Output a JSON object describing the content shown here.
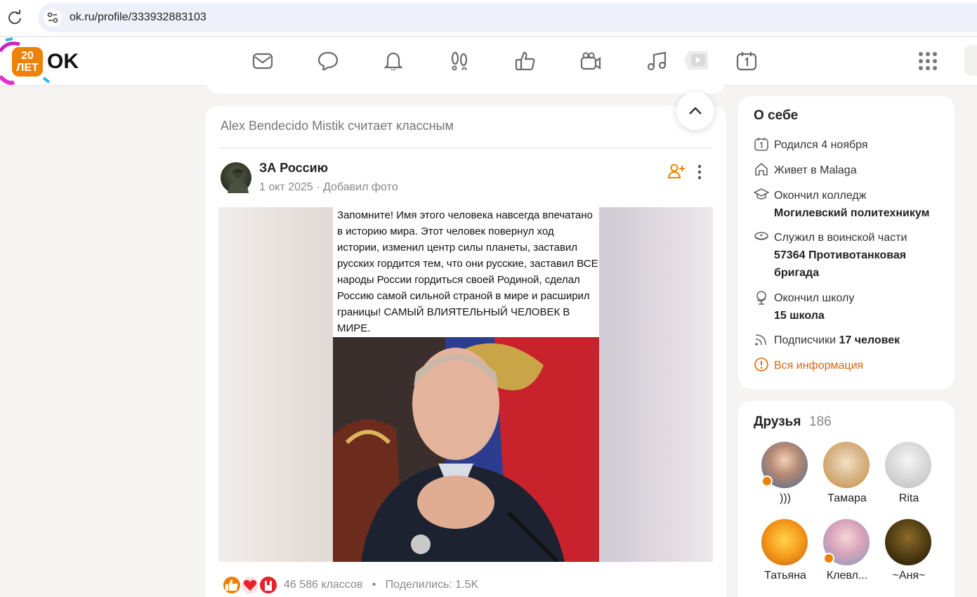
{
  "browser": {
    "url": "ok.ru/profile/333932883103"
  },
  "header": {
    "logo_badge": "20 ЛЕТ",
    "logo_text": "OK",
    "nav_icons": [
      "messages-icon",
      "discussions-icon",
      "notifications-icon",
      "guests-icon",
      "likes-icon",
      "video-icon",
      "music-icon",
      "video-play-icon",
      "calendar-icon"
    ],
    "accent": "#ee8208"
  },
  "feed": {
    "activity_header": "Alex Bendecido Mistik считает классным",
    "post": {
      "author": "ЗА Россию",
      "date": "1 окт 2025",
      "separator": "·",
      "action": "Добавил фото",
      "photo_text": "Запомните! Имя этого человека навсегда впечатано в историю мира. Этот человек повернул ход истории, изменил центр силы планеты, заставил русских гордится тем, что они русские, заставил ВСЕ народы России гордиться своей Родиной, сделал Россию самой сильной страной в мире и расширил границы! САМЫЙ ВЛИЯТЕЛЬНЫЙ ЧЕЛОВЕК В МИРЕ.",
      "likes": "46 586 классов",
      "dot": "•",
      "shares": "Поделились: 1.5K"
    }
  },
  "about": {
    "title": "О себе",
    "born_label": "Родился 4 ноября",
    "lives_label": "Живет в Malaga",
    "college_label": "Окончил колледж",
    "college_value": "Могилевский политехникум",
    "military_label": "Служил в воинской части",
    "military_value": "57364 Противотанковая бригада",
    "school_label": "Окончил школу",
    "school_value": "15 школа",
    "subscribers_label": "Подписчики",
    "subscribers_value": "17 человек",
    "all_info": "Вся информация"
  },
  "friends": {
    "title": "Друзья",
    "count": "186",
    "items": [
      {
        "name": ")))"
      },
      {
        "name": "Тамара"
      },
      {
        "name": "Rita"
      },
      {
        "name": "Татьяна"
      },
      {
        "name": "Клевл..."
      },
      {
        "name": "~Аня~"
      }
    ]
  }
}
